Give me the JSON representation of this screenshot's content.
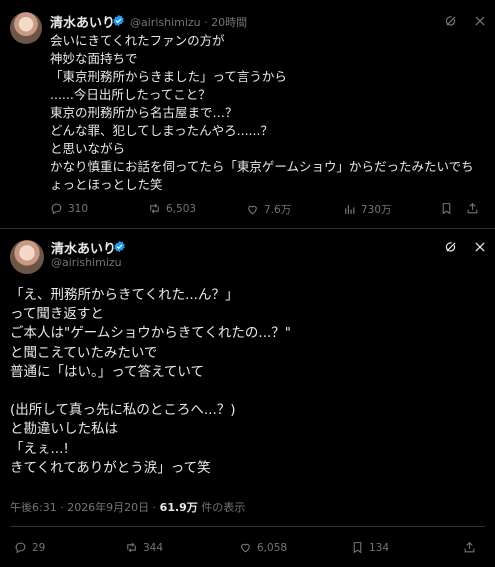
{
  "tweet1": {
    "name": "清水あいり",
    "handle": "@airishimizu",
    "time": "20時間",
    "lines": [
      "会いにきてくれたファンの方が",
      "神妙な面持ちで",
      "「東京刑務所からきました」って言うから",
      "......今日出所したってこと？",
      "東京の刑務所から名古屋まで…？",
      "どんな罪、犯してしまったんやろ......？",
      "と思いながら",
      "かなり慎重にお話を伺ってたら「東京ゲームショウ」からだったみたいでちょっとほっとした笑"
    ],
    "stats": {
      "replies": "310",
      "retweets": "6,503",
      "likes": "7.6万",
      "views": "730万"
    }
  },
  "tweet2": {
    "name": "清水あいり",
    "handle": "@airishimizu",
    "lines": [
      "「え、刑務所からきてくれた...ん？」",
      "って聞き返すと",
      "ご本人は\"ゲームショウからきてくれたの...？\"",
      "と聞こえていたみたいで",
      "普通に「はい。」って答えていて",
      "",
      "(出所して真っ先に私のところへ...？)",
      "と勘違いした私は",
      "「えぇ...!",
      "きてくれてありがとう涙」って笑"
    ],
    "timestamp": "午後6:31 · 2026年9月20日 · ",
    "views_count": "61.9万",
    "views_label": " 件の表示",
    "stats": {
      "replies": "29",
      "retweets": "344",
      "likes": "6,058",
      "bookmarks": "134"
    }
  },
  "colors": {
    "background": "#000000",
    "text": "#e7e9ea",
    "muted": "#71767b",
    "verified": "#1d9bf0",
    "divider": "#2f3336"
  },
  "icons": [
    "avatar",
    "verified-icon",
    "grok-icon",
    "close-icon",
    "reply-icon",
    "retweet-icon",
    "like-icon",
    "views-icon",
    "bookmark-icon",
    "share-icon"
  ]
}
